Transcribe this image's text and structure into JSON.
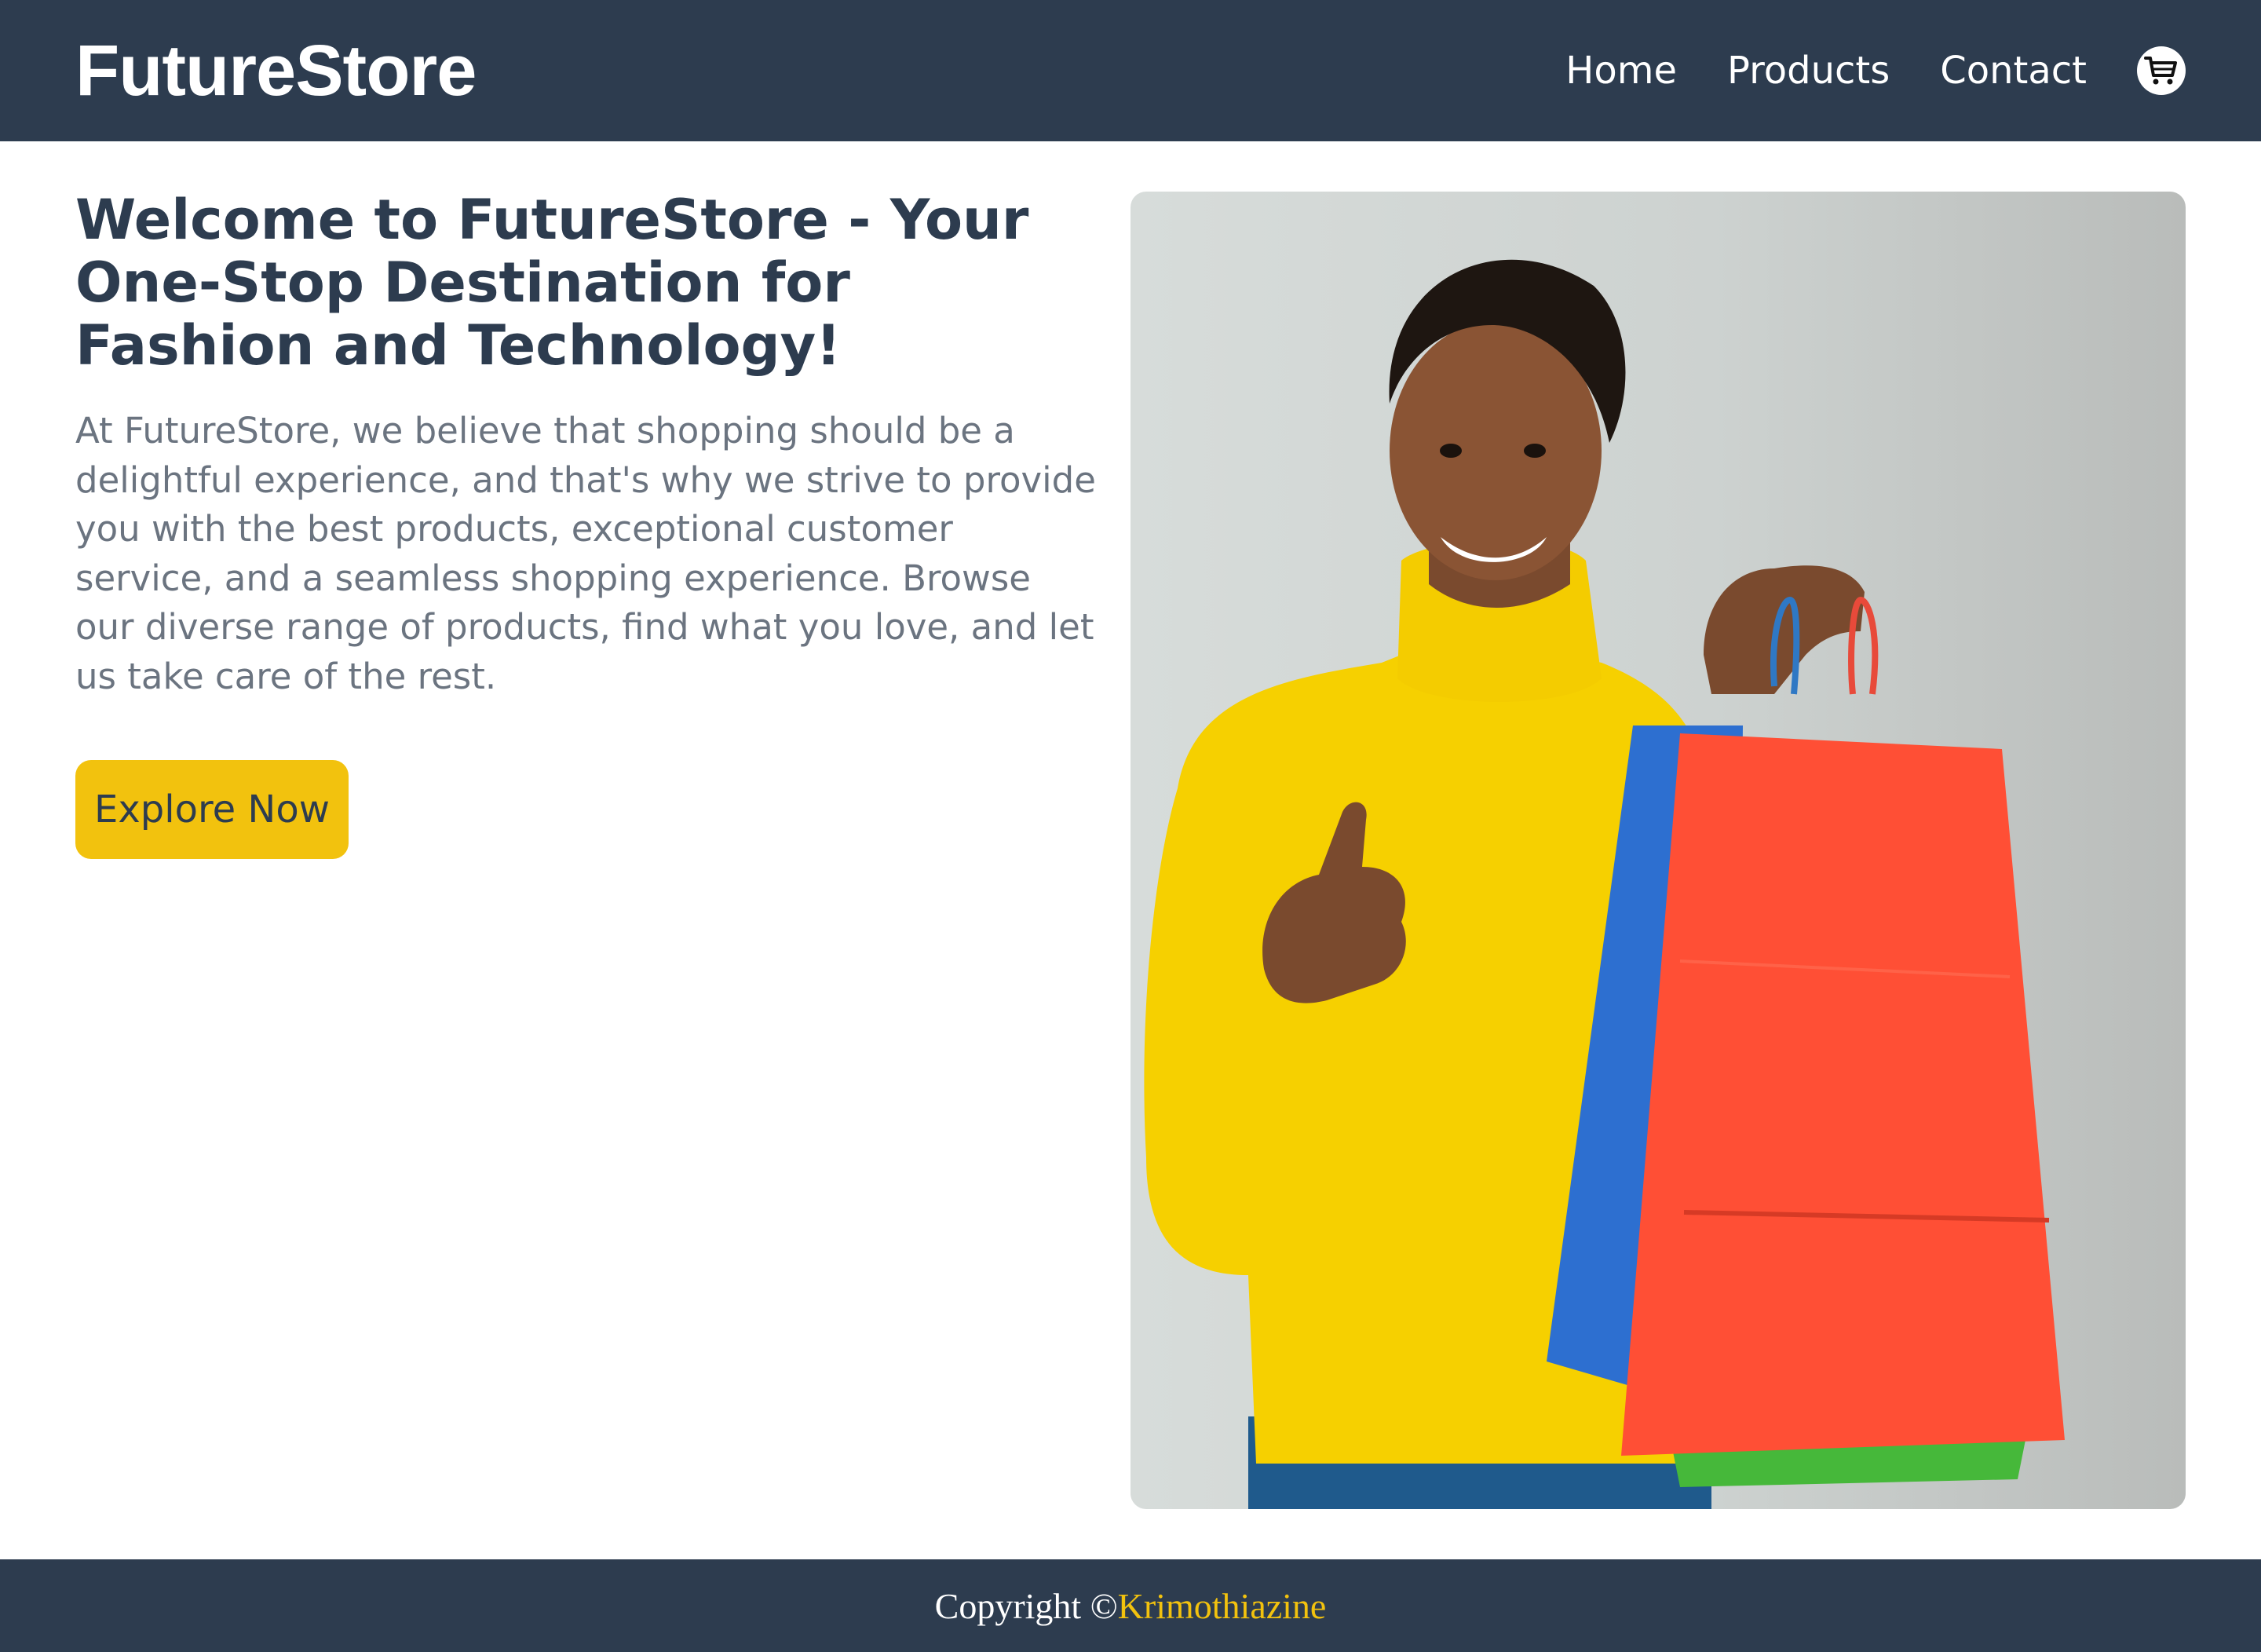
{
  "header": {
    "brand": "FutureStore",
    "nav": [
      "Home",
      "Products",
      "Contact"
    ],
    "cart_icon": "shopping-cart-icon"
  },
  "hero": {
    "title": "Welcome to FutureStore - Your One-Stop Destination for Fashion and Technology!",
    "body": "At FutureStore, we believe that shopping should be a delightful experience, and that's why we strive to provide you with the best products, exceptional customer service, and a seamless shopping experience. Browse our diverse range of products, find what you love, and let us take care of the rest.",
    "cta_label": "Explore Now"
  },
  "footer": {
    "copyright": "Copyright ©",
    "author": "Krimothiazine"
  },
  "colors": {
    "header_bg": "#2d3c4f",
    "accent": "#f2c20e",
    "title_text": "#2d3c4f",
    "body_text": "#6b7480"
  }
}
